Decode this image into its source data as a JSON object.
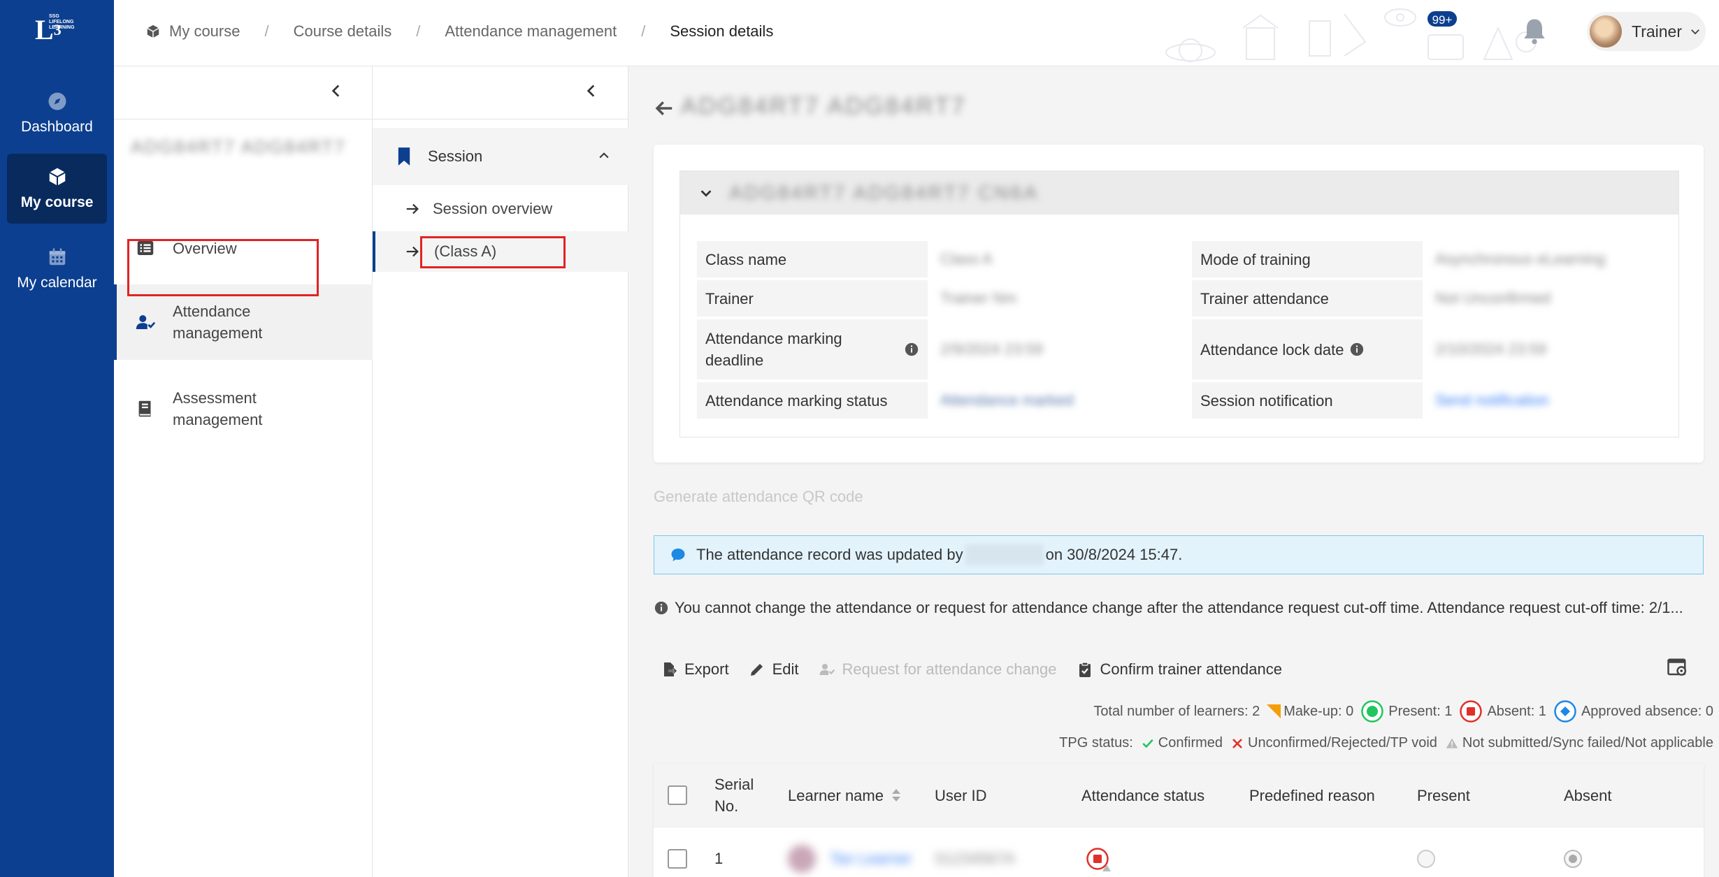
{
  "nav": {
    "items": [
      {
        "label": "Dashboard",
        "icon": "compass-icon"
      },
      {
        "label": "My course",
        "icon": "cube-icon"
      },
      {
        "label": "My calendar",
        "icon": "calendar-icon"
      }
    ]
  },
  "header": {
    "breadcrumbs": [
      "My course",
      "Course details",
      "Attendance management",
      "Session details"
    ],
    "notification_count": "99+",
    "user_name": "Trainer"
  },
  "course_panel": {
    "course_name": "ADG84RT7 ADG84RT7",
    "items": [
      {
        "label": "Overview"
      },
      {
        "label": "Attendance management"
      },
      {
        "label": "Assessment management"
      }
    ]
  },
  "session_panel": {
    "section_label": "Session",
    "items": [
      {
        "label": "Session overview"
      },
      {
        "label": "(Class A)"
      }
    ]
  },
  "main": {
    "session_title": "ADG84RT7 ADG84RT7",
    "collapse_title": "ADG84RT7 ADG84RT7 CN6A",
    "info": {
      "class_name_label": "Class name",
      "class_name_value": "Class A",
      "mode_label": "Mode of training",
      "mode_value": "Asynchronous eLearning",
      "trainer_label": "Trainer",
      "trainer_value": "Trainer Nm",
      "trainer_att_label": "Trainer attendance",
      "trainer_att_value": "Not Unconfirmed",
      "deadline_label": "Attendance marking deadline",
      "deadline_value": "2/9/2024 23:59",
      "lock_label": "Attendance lock date",
      "lock_value": "2/10/2024 23:59",
      "status_label": "Attendance marking status",
      "status_value": "Attendance marked",
      "notif_label": "Session notification",
      "notif_value": "Send notification"
    },
    "qr_link": "Generate attendance QR code",
    "alert_before": "The attendance record was updated by",
    "alert_after": "on 30/8/2024 15:47.",
    "warning": "You cannot change the attendance or request for attendance change after the attendance request cut-off time. Attendance request cut-off time: 2/1...",
    "toolbar": {
      "export": "Export",
      "edit": "Edit",
      "request": "Request for attendance change",
      "confirm": "Confirm trainer attendance"
    },
    "stats": {
      "total": "Total number of learners: 2",
      "makeup": "Make-up: 0",
      "present": "Present: 1",
      "absent": "Absent: 1",
      "approved": "Approved absence: 0"
    },
    "tpg": {
      "label": "TPG status:",
      "confirmed": "Confirmed",
      "unconfirmed": "Unconfirmed/Rejected/TP void",
      "not_submitted": "Not submitted/Sync failed/Not applicable"
    },
    "table": {
      "headers": [
        "Serial No.",
        "Learner name",
        "User ID",
        "Attendance status",
        "Predefined reason",
        "Present",
        "Absent"
      ],
      "rows": [
        {
          "serial": "1",
          "name": "Tan Learner",
          "user_id": "S1234567A"
        }
      ]
    }
  },
  "colors": {
    "nav_bg": "#0c3f8f",
    "accent_red": "#e02424",
    "present_green": "#22c55e",
    "absent_red": "#e0302a",
    "approved_blue": "#1e88e5",
    "makeup_orange": "#f59e0b"
  }
}
